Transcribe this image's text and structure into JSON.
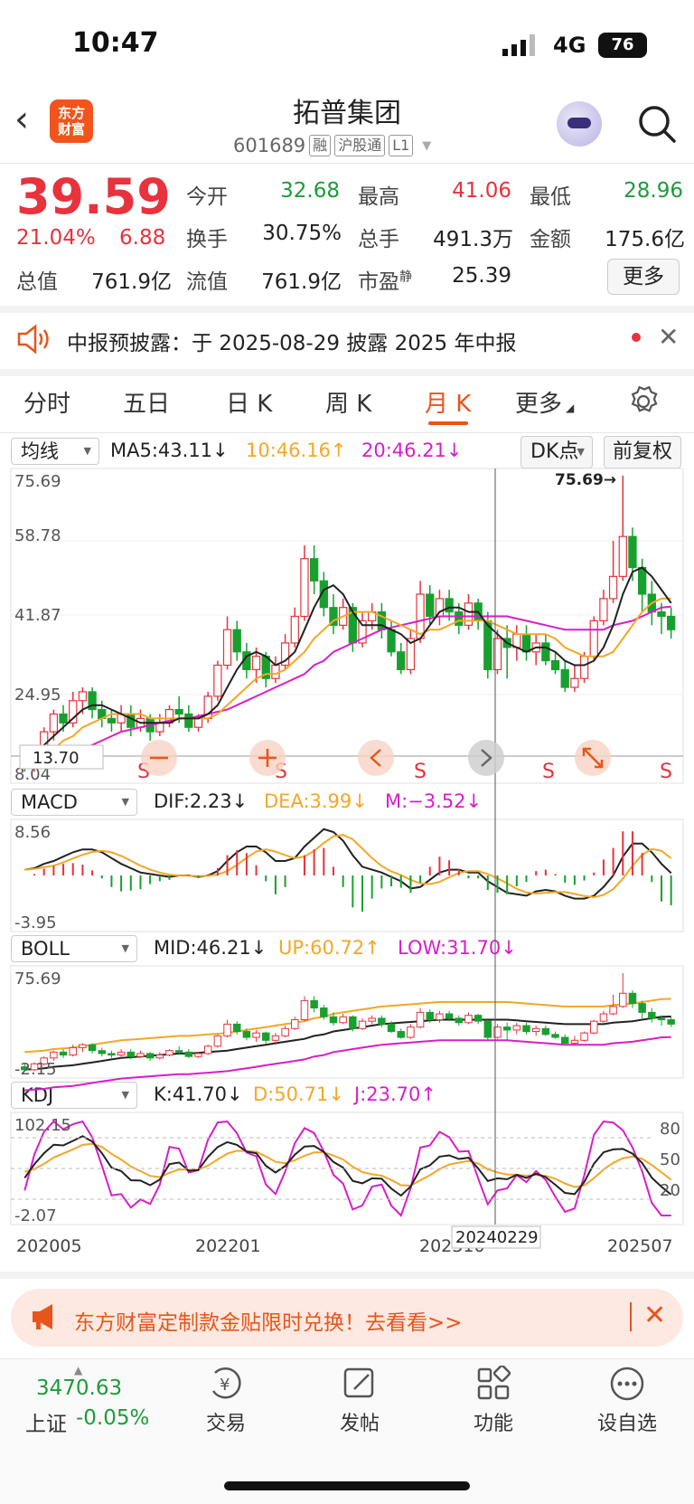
{
  "status": {
    "time": "10:47",
    "network": "4G",
    "battery": "76"
  },
  "header": {
    "logo_line1": "东方",
    "logo_line2": "财富",
    "name": "拓普集团",
    "code": "601689",
    "tags": [
      "融",
      "沪股通",
      "L1"
    ]
  },
  "quote": {
    "price": "39.59",
    "pct": "21.04%",
    "chg": "6.88",
    "fields": [
      {
        "label": "今开",
        "value": "32.68",
        "color": "green"
      },
      {
        "label": "最高",
        "value": "41.06",
        "color": "red"
      },
      {
        "label": "最低",
        "value": "28.96",
        "color": "green"
      },
      {
        "label": "换手",
        "value": "30.75%",
        "color": "dark"
      },
      {
        "label": "总手",
        "value": "491.3万",
        "color": "dark"
      },
      {
        "label": "金额",
        "value": "175.6亿",
        "color": "dark"
      },
      {
        "label": "总值",
        "value": "761.9亿",
        "color": "dark"
      },
      {
        "label": "流值",
        "value": "761.9亿",
        "color": "dark"
      },
      {
        "label": "市盈",
        "sup": "静",
        "value": "25.39",
        "color": "dark"
      }
    ],
    "more": "更多"
  },
  "notice": {
    "text": "中报预披露：于 2025-08-29 披露 2025 年中报"
  },
  "tabs": [
    "分时",
    "五日",
    "日 K",
    "周 K",
    "月 K",
    "更多"
  ],
  "active_tab": "月 K",
  "main_panel": {
    "selector": "均线",
    "ma5": "MA5:43.11↓",
    "ma10": "10:46.16↑",
    "ma20": "20:46.21↓",
    "dk_button": "DK点",
    "adjust_button": "前复权",
    "y_labels": [
      "75.69",
      "58.78",
      "41.87",
      "24.95",
      "8.04"
    ],
    "high_marker": "75.69→",
    "low_marker": "13.70",
    "sell_marks": [
      "S",
      "S",
      "S",
      "S",
      "S"
    ]
  },
  "macd_panel": {
    "selector": "MACD",
    "dif": "DIF:2.23↓",
    "dea": "DEA:3.99↓",
    "m": "M:−3.52↓",
    "y_labels": [
      "8.56",
      "-3.95"
    ]
  },
  "boll_panel": {
    "selector": "BOLL",
    "mid": "MID:46.21↓",
    "up": "UP:60.72↑",
    "low": "LOW:31.70↓",
    "y_labels": [
      "75.69",
      "-2.15"
    ]
  },
  "kdj_panel": {
    "selector": "KDJ",
    "k": "K:41.70↓",
    "d": "D:50.71↓",
    "j": "J:23.70↑",
    "y_labels": [
      "102.15",
      "-2.07"
    ],
    "right_labels": [
      "80",
      "50",
      "20"
    ]
  },
  "x_labels": [
    "202005",
    "202201",
    "202310",
    "202507"
  ],
  "crosshair_date": "20240229",
  "chart_data": {
    "type": "candlestick",
    "title": "拓普集团 月K",
    "ylim": [
      8.04,
      75.69
    ],
    "candles": [
      [
        12,
        10,
        14,
        9
      ],
      [
        10,
        14,
        15,
        9
      ],
      [
        14,
        18,
        19,
        13
      ],
      [
        18,
        22,
        23,
        16
      ],
      [
        22,
        20,
        24,
        18
      ],
      [
        20,
        25,
        27,
        19
      ],
      [
        25,
        27,
        28,
        22
      ],
      [
        27,
        23,
        28,
        21
      ],
      [
        23,
        21,
        25,
        19
      ],
      [
        21,
        20,
        23,
        18
      ],
      [
        20,
        22,
        24,
        18
      ],
      [
        22,
        19,
        24,
        17
      ],
      [
        19,
        21,
        23,
        18
      ],
      [
        21,
        18,
        22,
        16
      ],
      [
        18,
        20,
        22,
        17
      ],
      [
        20,
        23,
        24,
        19
      ],
      [
        23,
        22,
        26,
        20
      ],
      [
        22,
        19,
        24,
        18
      ],
      [
        19,
        21,
        22,
        18
      ],
      [
        21,
        26,
        27,
        20
      ],
      [
        26,
        33,
        34,
        25
      ],
      [
        33,
        41,
        44,
        32
      ],
      [
        41,
        36,
        43,
        34
      ],
      [
        36,
        32,
        38,
        30
      ],
      [
        32,
        35,
        37,
        29
      ],
      [
        35,
        30,
        36,
        28
      ],
      [
        30,
        33,
        35,
        29
      ],
      [
        33,
        38,
        40,
        32
      ],
      [
        38,
        44,
        46,
        37
      ],
      [
        44,
        57,
        60,
        43
      ],
      [
        57,
        52,
        60,
        49
      ],
      [
        52,
        46,
        54,
        44
      ],
      [
        46,
        42,
        49,
        40
      ],
      [
        42,
        46,
        48,
        41
      ],
      [
        46,
        38,
        47,
        36
      ],
      [
        38,
        43,
        45,
        37
      ],
      [
        43,
        45,
        47,
        41
      ],
      [
        45,
        41,
        47,
        39
      ],
      [
        41,
        36,
        43,
        35
      ],
      [
        36,
        32,
        38,
        31
      ],
      [
        32,
        39,
        41,
        31
      ],
      [
        39,
        49,
        52,
        38
      ],
      [
        49,
        44,
        51,
        42
      ],
      [
        44,
        48,
        50,
        42
      ],
      [
        48,
        45,
        50,
        43
      ],
      [
        45,
        42,
        47,
        40
      ],
      [
        42,
        47,
        49,
        41
      ],
      [
        47,
        43,
        48,
        41
      ],
      [
        43,
        32,
        45,
        30
      ],
      [
        32,
        39,
        41,
        31
      ],
      [
        39,
        37,
        42,
        30
      ],
      [
        37,
        40,
        42,
        34
      ],
      [
        40,
        36,
        42,
        34
      ],
      [
        36,
        38,
        40,
        33
      ],
      [
        38,
        34,
        40,
        33
      ],
      [
        34,
        32,
        36,
        31
      ],
      [
        32,
        28,
        34,
        27
      ],
      [
        28,
        30,
        33,
        27
      ],
      [
        30,
        35,
        36,
        29
      ],
      [
        35,
        43,
        44,
        34
      ],
      [
        43,
        48,
        50,
        42
      ],
      [
        48,
        53,
        61,
        47
      ],
      [
        53,
        62,
        75.69,
        52
      ],
      [
        62,
        55,
        64,
        52
      ],
      [
        55,
        49,
        57,
        45
      ],
      [
        49,
        45,
        52,
        42
      ],
      [
        45,
        44,
        47,
        40
      ],
      [
        44,
        41,
        46,
        39
      ]
    ],
    "ma5": [
      12,
      13,
      15,
      17,
      19,
      21,
      23,
      24,
      24,
      23,
      22,
      21,
      20,
      20,
      20,
      20,
      21,
      21,
      21,
      22,
      24,
      28,
      32,
      35,
      36,
      35,
      33,
      34,
      36,
      41,
      46,
      50,
      51,
      49,
      45,
      42,
      42,
      42,
      41,
      40,
      38,
      39,
      42,
      45,
      46,
      46,
      45,
      45,
      42,
      40,
      38,
      37,
      36,
      37,
      37,
      36,
      34,
      33,
      33,
      34,
      37,
      42,
      49,
      54,
      55,
      53,
      50,
      47
    ],
    "ma10": [
      11,
      12,
      13,
      14,
      16,
      17,
      19,
      20,
      21,
      22,
      22,
      22,
      22,
      21,
      21,
      21,
      21,
      21,
      21,
      21,
      22,
      24,
      26,
      28,
      30,
      31,
      31,
      32,
      34,
      36,
      39,
      41,
      43,
      44,
      45,
      45,
      45,
      44,
      43,
      42,
      41,
      40,
      41,
      41,
      42,
      43,
      43,
      43,
      43,
      42,
      41,
      40,
      40,
      40,
      40,
      39,
      37,
      36,
      35,
      35,
      35,
      36,
      39,
      42,
      45,
      47,
      48,
      48
    ],
    "ma20": [
      10,
      10.5,
      11,
      12,
      12.5,
      13,
      14,
      15,
      16,
      17,
      18,
      18.5,
      19,
      19.5,
      20,
      20.5,
      21,
      21,
      21.5,
      22,
      22.5,
      23,
      24,
      25,
      26,
      27,
      28,
      29,
      30,
      31,
      33,
      34,
      36,
      37,
      38,
      39,
      40,
      41,
      41.5,
      42,
      42.5,
      43,
      43.5,
      44,
      44,
      44,
      44,
      44,
      44,
      44,
      44,
      43.5,
      43,
      42.5,
      42,
      41.5,
      41,
      41,
      41,
      41,
      41,
      42,
      42.5,
      43,
      44,
      45,
      46,
      46.2
    ]
  }
}
